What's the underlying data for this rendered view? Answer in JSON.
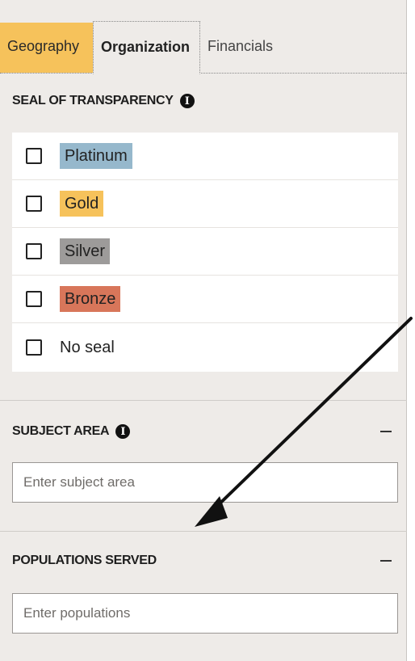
{
  "tabs": [
    {
      "label": "Geography",
      "active": false,
      "bg": "#f6c25b"
    },
    {
      "label": "Organization",
      "active": true
    },
    {
      "label": "Financials",
      "active": false
    }
  ],
  "seal": {
    "heading": "SEAL OF TRANSPARENCY",
    "info_icon": "info-circle-icon",
    "items": [
      {
        "label": "Platinum",
        "color": "#96b8cc",
        "checked": false
      },
      {
        "label": "Gold",
        "color": "#f6c25b",
        "checked": false
      },
      {
        "label": "Silver",
        "color": "#9d9b9a",
        "checked": false
      },
      {
        "label": "Bronze",
        "color": "#d8765a",
        "checked": false
      },
      {
        "label": "No seal",
        "color": "",
        "checked": false
      }
    ]
  },
  "subject_area": {
    "heading": "SUBJECT AREA",
    "info_icon": "info-circle-icon",
    "collapse_icon": "minus-icon",
    "placeholder": "Enter subject area",
    "value": ""
  },
  "populations": {
    "heading": "POPULATIONS SERVED",
    "collapse_icon": "minus-icon",
    "placeholder": "Enter populations",
    "value": ""
  },
  "annotation": {
    "icon": "arrow-annotation",
    "color": "#111111"
  }
}
